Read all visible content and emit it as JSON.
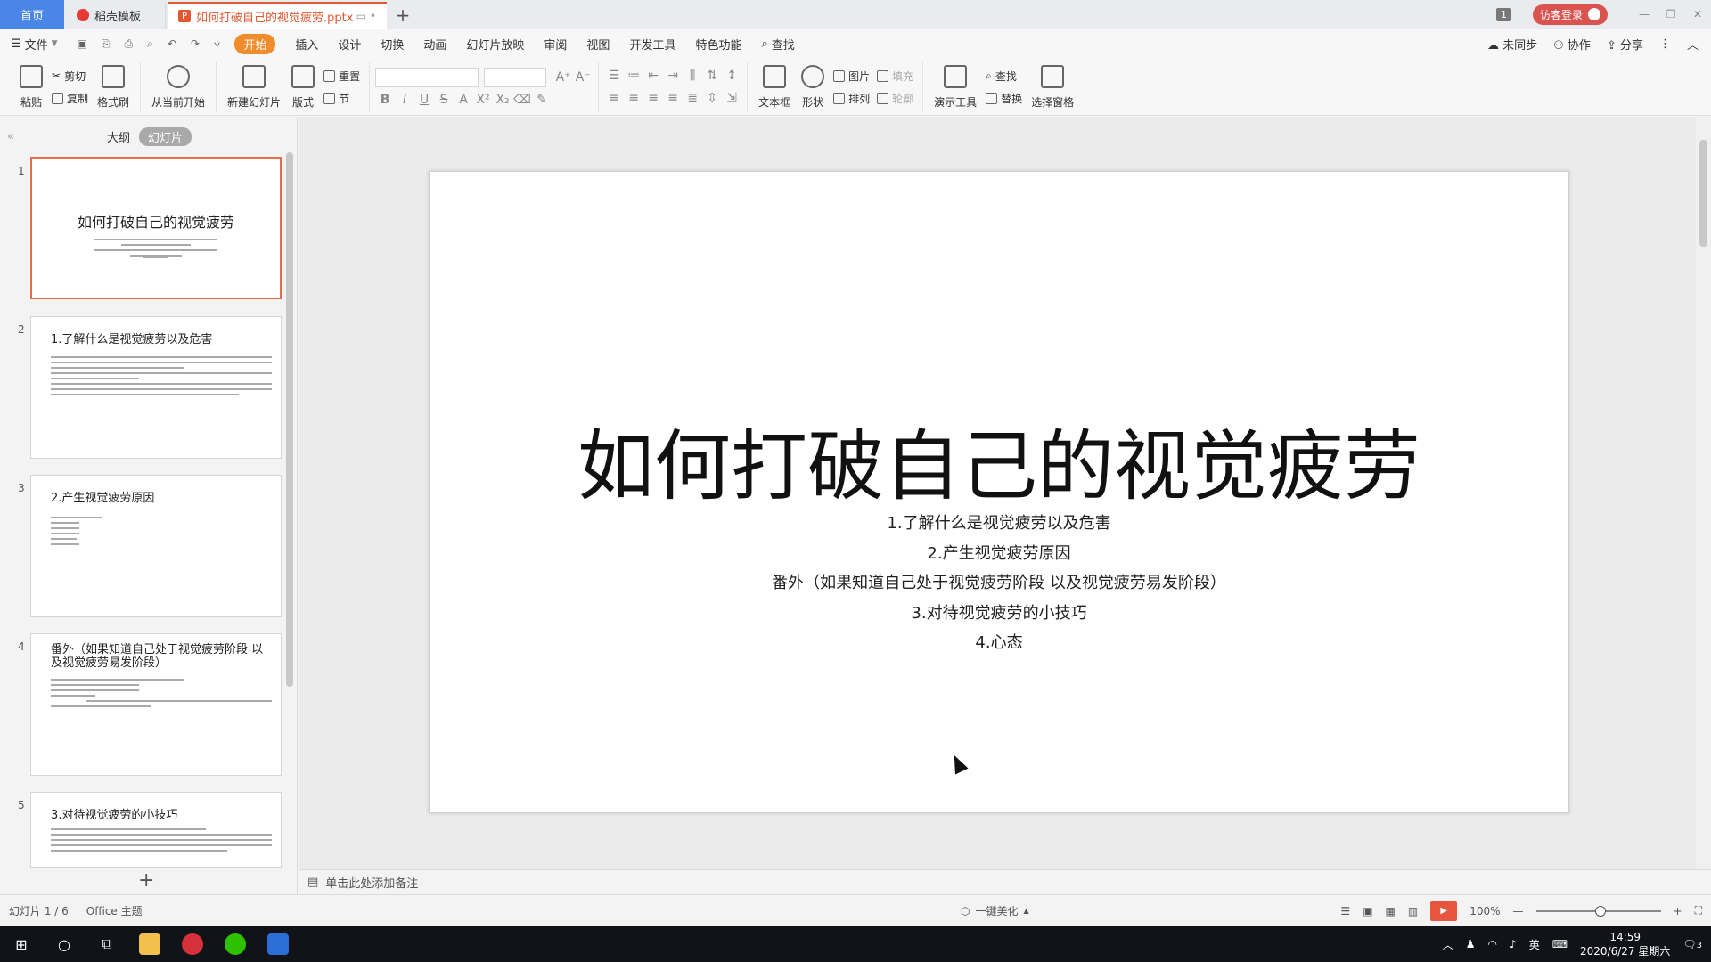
{
  "titlebar": {
    "tabs": [
      "首页",
      "稻壳模板",
      "如何打破自己的视觉疲劳.pptx"
    ],
    "badge_num": "1",
    "login": "访客登录"
  },
  "menubar": {
    "file": "文件",
    "items": [
      "开始",
      "插入",
      "设计",
      "切换",
      "动画",
      "幻灯片放映",
      "审阅",
      "视图",
      "开发工具",
      "特色功能"
    ],
    "search": "查找",
    "right": [
      "未同步",
      "协作",
      "分享"
    ]
  },
  "ribbon": {
    "paste": "粘贴",
    "cut": "剪切",
    "copy": "复制",
    "format_painter": "格式刷",
    "from_current": "从当前开始",
    "new_slide": "新建幻灯片",
    "layout": "版式",
    "reset": "重置",
    "section": "节",
    "textbox": "文本框",
    "shape": "形状",
    "picture": "图片",
    "fill": "填充",
    "arrange": "排列",
    "outline": "轮廓",
    "present_tools": "演示工具",
    "find": "查找",
    "replace": "替换",
    "selection_pane": "选择窗格"
  },
  "panel": {
    "tab_outline": "大纲",
    "tab_slides": "幻灯片",
    "thumbnails": [
      {
        "num": "1",
        "title": "如何打破自己的视觉疲劳"
      },
      {
        "num": "2",
        "title": "1.了解什么是视觉疲劳以及危害"
      },
      {
        "num": "3",
        "title": "2.产生视觉疲劳原因"
      },
      {
        "num": "4",
        "title": "番外（如果知道自己处于视觉疲劳阶段 以及视觉疲劳易发阶段）"
      },
      {
        "num": "5",
        "title": "3.对待视觉疲劳的小技巧"
      }
    ]
  },
  "slide": {
    "title": "如何打破自己的视觉疲劳",
    "lines": [
      "1.了解什么是视觉疲劳以及危害",
      "2.产生视觉疲劳原因",
      "番外（如果知道自己处于视觉疲劳阶段 以及视觉疲劳易发阶段）",
      "3.对待视觉疲劳的小技巧",
      "4.心态"
    ]
  },
  "notes": {
    "placeholder": "单击此处添加备注"
  },
  "status": {
    "slide_count": "幻灯片 1 / 6",
    "theme": "Office 主题",
    "beautify": "一键美化",
    "zoom": "100%"
  },
  "taskbar": {
    "ime": "英",
    "time": "14:59",
    "date": "2020/6/27 星期六",
    "notif": "3"
  }
}
